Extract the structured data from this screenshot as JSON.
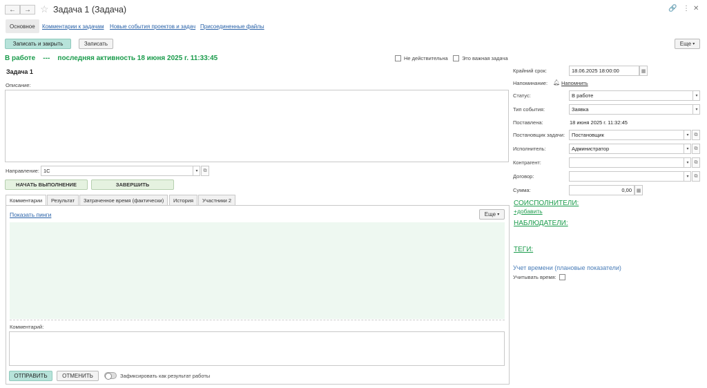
{
  "window": {
    "title": "Задача 1 (Задача)",
    "back_icon": "←",
    "forward_icon": "→"
  },
  "tabs": [
    "Основное",
    "Комментарии к задачам",
    "Новые события проектов и задач",
    "Присоединенные файлы"
  ],
  "toolbar": {
    "save_close": "Записать и закрыть",
    "save": "Записать",
    "more": "Еще"
  },
  "status": {
    "state": "В работе",
    "separator": "---",
    "activity": "последняя активность 18 июня 2025 г. 11:33:45",
    "not_valid": "Не действительна",
    "important": "Это важная задача"
  },
  "task": {
    "name": "Задача 1",
    "description_label": "Описание:",
    "direction_label": "Направление:",
    "direction_value": "1С",
    "start_button": "НАЧАТЬ ВЫПОЛНЕНИЕ",
    "finish_button": "ЗАВЕРШИТЬ"
  },
  "inner_tabs": [
    "Комментарии",
    "Результат",
    "Затраченное время (фактически)",
    "История",
    "Участники 2"
  ],
  "comments": {
    "show_pings": "Показать пинги",
    "more": "Еще",
    "comment_label": "Комментарий:",
    "send": "ОТПРАВИТЬ",
    "cancel": "ОТМЕНИТЬ",
    "fix_result": "Зафиксировать как результат работы"
  },
  "right": {
    "deadline_label": "Крайний срок:",
    "deadline_value": "18.06.2025 18:00:00",
    "reminder_label": "Напоминание:",
    "reminder_link": "Напомнить",
    "status_label": "Статус:",
    "status_value": "В работе",
    "event_type_label": "Тип события:",
    "event_type_value": "Заявка",
    "posted_label": "Поставлена:",
    "posted_value": "18 июня 2025 г. 11:32:45",
    "setter_label": "Постановщик задачи:",
    "setter_value": "Постановщик",
    "executor_label": "Исполнитель:",
    "executor_value": "Администратор",
    "counterparty_label": "Контрагент:",
    "contract_label": "Договор:",
    "sum_label": "Сумма:",
    "sum_value": "0,00",
    "coexecutors": "СОИСПОЛНИТЕЛИ:",
    "add": "+добавить",
    "observers": "НАБЛЮДАТЕЛИ:",
    "tags": "ТЕГИ:",
    "time_accounting": "Учет времени (плановые показатели)",
    "account_time_label": "Учитывать время:"
  }
}
